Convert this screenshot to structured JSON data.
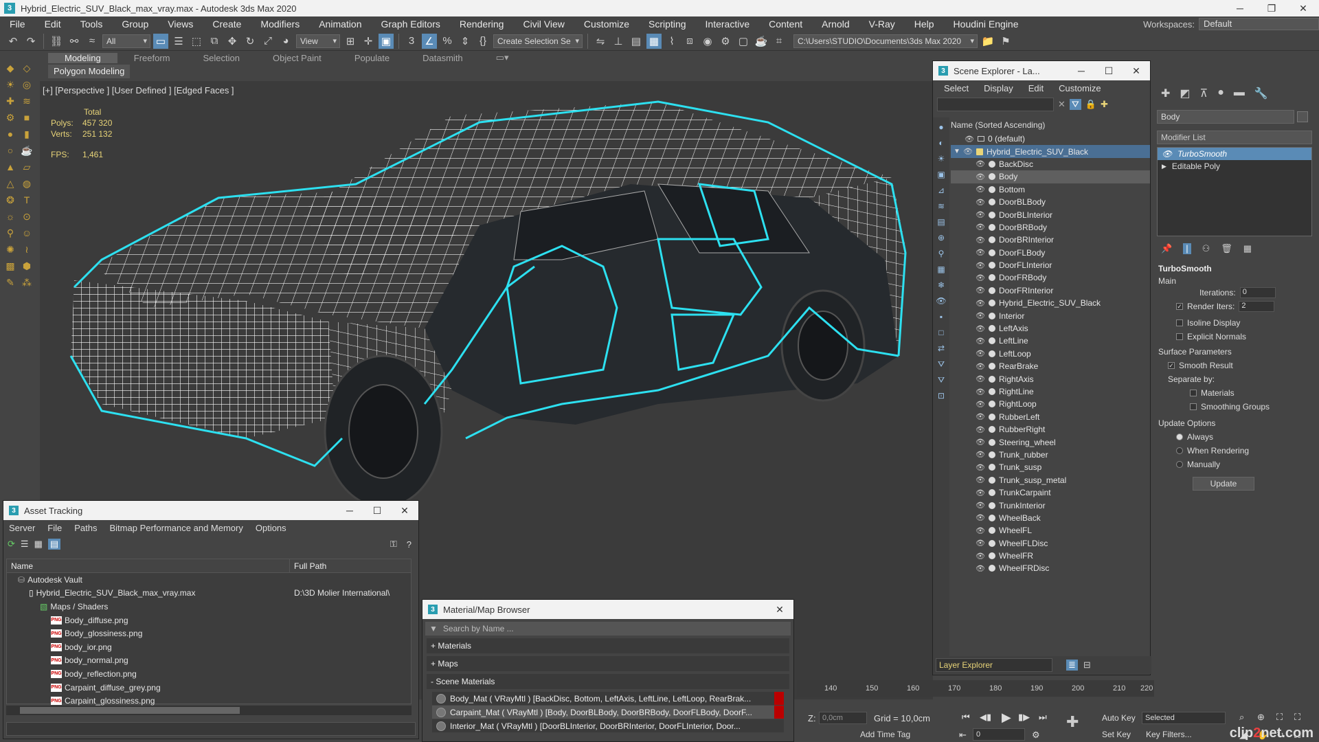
{
  "app": {
    "title": "Hybrid_Electric_SUV_Black_max_vray.max - Autodesk 3ds Max 2020",
    "window_controls": [
      "─",
      "❐",
      "✕"
    ]
  },
  "menubar": {
    "items": [
      "File",
      "Edit",
      "Tools",
      "Group",
      "Views",
      "Create",
      "Modifiers",
      "Animation",
      "Graph Editors",
      "Rendering",
      "Civil View",
      "Customize",
      "Scripting",
      "Interactive",
      "Content",
      "Arnold",
      "V-Ray",
      "Help",
      "Houdini Engine"
    ],
    "workspace_label": "Workspaces:",
    "workspace_value": "Default"
  },
  "toolbar": {
    "filter_value": "All",
    "refcoord_value": "View",
    "selection_set_placeholder": "Create Selection Se",
    "project_path": "C:\\Users\\STUDIO\\Documents\\3ds Max 2020"
  },
  "ribbon": {
    "tabs": [
      "Modeling",
      "Freeform",
      "Selection",
      "Object Paint",
      "Populate",
      "Datasmith"
    ],
    "active_tab": "Modeling",
    "sub_label": "Polygon Modeling"
  },
  "viewport": {
    "label": "[+] [Perspective ] [User Defined ] [Edged Faces ]",
    "stats": {
      "total_label": "Total",
      "polys_label": "Polys:",
      "polys_value": "457 320",
      "verts_label": "Verts:",
      "verts_value": "251 132",
      "fps_label": "FPS:",
      "fps_value": "1,461"
    },
    "colors": {
      "background": "#3b3b3b",
      "wire": "#ffffff",
      "selection": "#2de0f0"
    }
  },
  "scene_explorer": {
    "title": "Scene Explorer - La...",
    "menu": [
      "Select",
      "Display",
      "Edit",
      "Customize"
    ],
    "column_header": "Name (Sorted Ascending)",
    "default_layer": "0 (default)",
    "parent_layer": "Hybrid_Electric_SUV_Black",
    "objects": [
      "BackDisc",
      "Body",
      "Bottom",
      "DoorBLBody",
      "DoorBLInterior",
      "DoorBRBody",
      "DoorBRInterior",
      "DoorFLBody",
      "DoorFLInterior",
      "DoorFRBody",
      "DoorFRInterior",
      "Hybrid_Electric_SUV_Black",
      "Interior",
      "LeftAxis",
      "LeftLine",
      "LeftLoop",
      "RearBrake",
      "RightAxis",
      "RightLine",
      "RightLoop",
      "RubberLeft",
      "RubberRight",
      "Steering_wheel",
      "Trunk_rubber",
      "Trunk_susp",
      "Trunk_susp_metal",
      "TrunkCarpaint",
      "TrunkInterior",
      "WheelBack",
      "WheelFL",
      "WheelFLDisc",
      "WheelFR",
      "WheelFRDisc"
    ],
    "highlighted_object": "Body",
    "bottom_explorer": "Layer Explorer"
  },
  "command_panel": {
    "object_name": "Body",
    "modifier_list_label": "Modifier List",
    "stack": [
      "TurboSmooth",
      "Editable Poly"
    ],
    "turbosmooth": {
      "title": "TurboSmooth",
      "main_label": "Main",
      "iterations_label": "Iterations:",
      "iterations_value": "0",
      "render_iters_label": "Render Iters:",
      "render_iters_value": "2",
      "isoline_label": "Isoline Display",
      "explicit_normals_label": "Explicit Normals",
      "surface_params_label": "Surface Parameters",
      "smooth_result_label": "Smooth Result",
      "separate_by_label": "Separate by:",
      "materials_label": "Materials",
      "smoothing_groups_label": "Smoothing Groups",
      "update_options_label": "Update Options",
      "always_label": "Always",
      "when_rendering_label": "When Rendering",
      "manually_label": "Manually",
      "update_button": "Update"
    }
  },
  "asset_tracking": {
    "title": "Asset Tracking",
    "menu": [
      "Server",
      "File",
      "Paths",
      "Bitmap Performance and Memory",
      "Options"
    ],
    "col_name": "Name",
    "col_path": "Full Path",
    "rows": [
      {
        "name": "Autodesk Vault",
        "path": "",
        "indent": 1,
        "kind": "vault"
      },
      {
        "name": "Hybrid_Electric_SUV_Black_max_vray.max",
        "path": "D:\\3D Molier International\\",
        "indent": 2,
        "kind": "file"
      },
      {
        "name": "Maps / Shaders",
        "path": "",
        "indent": 3,
        "kind": "maps"
      },
      {
        "name": "Body_diffuse.png",
        "path": "",
        "indent": 4,
        "kind": "png"
      },
      {
        "name": "Body_glossiness.png",
        "path": "",
        "indent": 4,
        "kind": "png"
      },
      {
        "name": "body_ior.png",
        "path": "",
        "indent": 4,
        "kind": "png"
      },
      {
        "name": "body_normal.png",
        "path": "",
        "indent": 4,
        "kind": "png"
      },
      {
        "name": "body_reflection.png",
        "path": "",
        "indent": 4,
        "kind": "png"
      },
      {
        "name": "Carpaint_diffuse_grey.png",
        "path": "",
        "indent": 4,
        "kind": "png"
      },
      {
        "name": "Carpaint_glossiness.png",
        "path": "",
        "indent": 4,
        "kind": "png"
      }
    ]
  },
  "material_browser": {
    "title": "Material/Map Browser",
    "search_placeholder": "Search by Name ...",
    "sections": [
      "+ Materials",
      "+ Maps",
      "- Scene Materials"
    ],
    "scene_materials": [
      "Body_Mat  ( VRayMtl ) [BackDisc, Bottom, LeftAxis, LeftLine, LeftLoop, RearBrak...",
      "Carpaint_Mat  ( VRayMtl ) [Body, DoorBLBody, DoorBRBody, DoorFLBody, DoorF...",
      "Interior_Mat  ( VRayMtl ) [DoorBLInterior, DoorBRInterior, DoorFLInterior, Door..."
    ]
  },
  "timeline": {
    "ticks": [
      "140",
      "150",
      "160",
      "170",
      "180",
      "190",
      "200",
      "210",
      "220"
    ]
  },
  "status": {
    "z_label": "Z:",
    "z_value": "0,0cm",
    "grid_label": "Grid = 10,0cm",
    "add_time_tag": "Add Time Tag",
    "auto_key": "Auto Key",
    "set_key": "Set Key",
    "selected_value": "Selected",
    "key_filters": "Key Filters...",
    "frame_value": "0"
  },
  "watermark": {
    "text_a": "clip",
    "text_b": "2",
    "text_c": "net.com"
  }
}
